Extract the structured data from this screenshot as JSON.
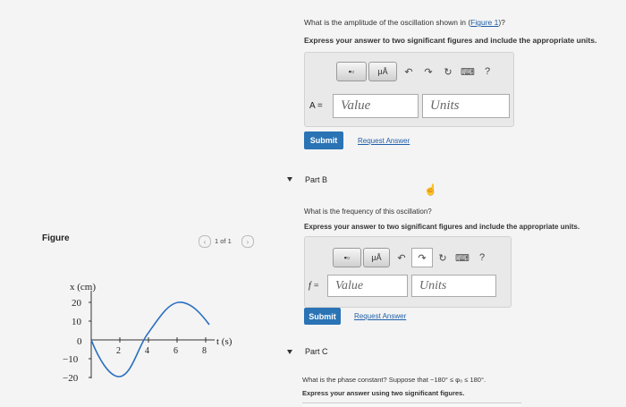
{
  "partA": {
    "question": "What is the amplitude of the oscillation shown in (",
    "figure_link": "Figure 1",
    "question_end": ")?",
    "instruction": "Express your answer to two significant figures and include the appropriate units.",
    "var_label": "A =",
    "value_placeholder": "Value",
    "units_placeholder": "Units",
    "submit": "Submit",
    "request": "Request Answer"
  },
  "partB": {
    "title": "Part B",
    "question": "What is the frequency of this oscillation?",
    "instruction": "Express your answer to two significant figures and include the appropriate units.",
    "var_label": "f =",
    "value_placeholder": "Value",
    "units_placeholder": "Units",
    "submit": "Submit",
    "request": "Request Answer"
  },
  "partC": {
    "title": "Part C",
    "question": "What is the phase constant? Suppose that −180° ≤ φ₀ ≤ 180°.",
    "instruction": "Express your answer using two significant figures."
  },
  "toolbar": {
    "unit_btn": "μÅ",
    "help": "?"
  },
  "figure": {
    "title": "Figure",
    "pager": "1 of 1",
    "ylabel": "x (cm)",
    "xlabel": "t (s)",
    "yticks": [
      "20",
      "10",
      "0",
      "−10",
      "−20"
    ],
    "xticks": [
      "2",
      "4",
      "6",
      "8"
    ]
  }
}
